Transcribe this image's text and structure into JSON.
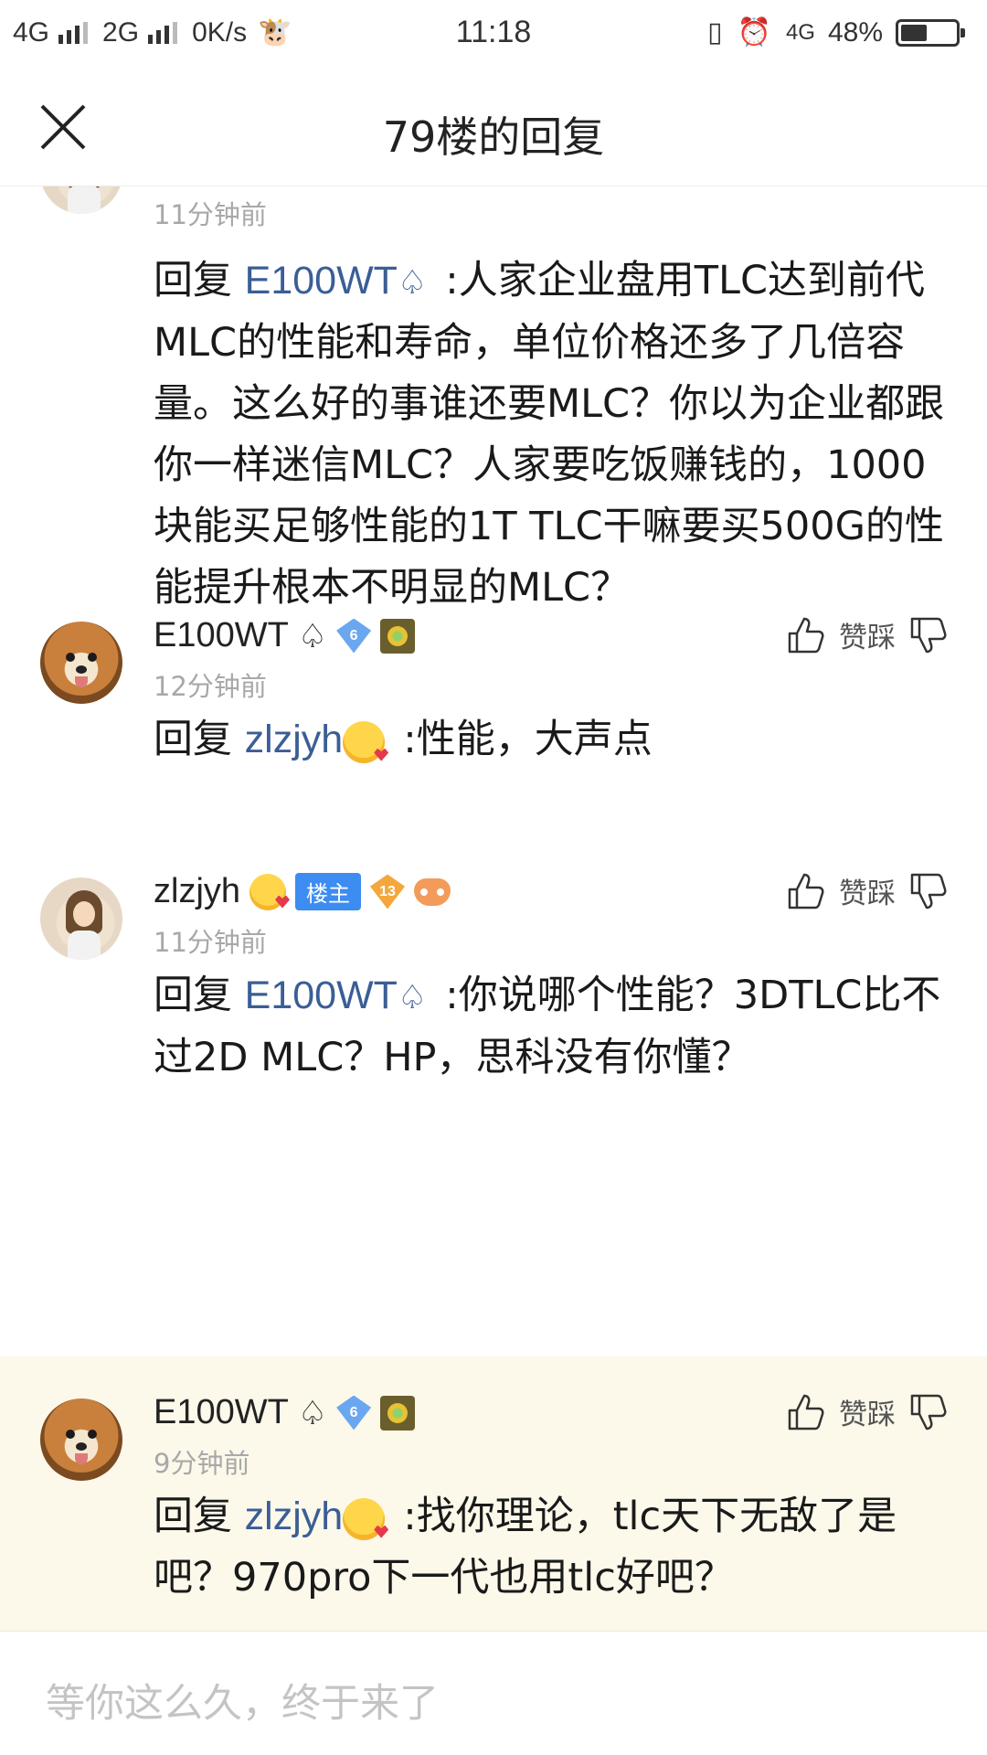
{
  "status_bar": {
    "network_1": "4G",
    "network_2": "2G",
    "speed": "0K/s",
    "time": "11:18",
    "network_3": "4G",
    "battery": "48%",
    "battery_level": 0.48
  },
  "header": {
    "title": "79楼的回复"
  },
  "replies": [
    {
      "time": "11分钟前",
      "reply_prefix": "回复",
      "mention": "E100WT",
      "body": ":人家企业盘用TLC达到前代MLC的性能和寿命，单位价格还多了几倍容量。这么好的事谁还要MLC？你以为企业都跟你一样迷信MLC？人家要吃饭赚钱的，1000块能买足够性能的1T TLC干嘛要买500G的性能提升根本不明显的MLC？"
    },
    {
      "username": "E100WT",
      "level": "6",
      "time": "12分钟前",
      "actions_label": "赞踩",
      "reply_prefix": "回复",
      "mention": "zlzjyh",
      "body": ":性能，大声点"
    },
    {
      "username": "zlzjyh",
      "owner_badge": "楼主",
      "level": "13",
      "time": "11分钟前",
      "actions_label": "赞踩",
      "reply_prefix": "回复",
      "mention": "E100WT",
      "body": ":你说哪个性能？3DTLC比不过2D MLC？HP，思科没有你懂？"
    },
    {
      "username": "E100WT",
      "level": "6",
      "time": "9分钟前",
      "actions_label": "赞踩",
      "reply_prefix": "回复",
      "mention": "zlzjyh",
      "body": ":找你理论，tlc天下无敌了是吧？970pro下一代也用tlc好吧？"
    }
  ],
  "input": {
    "placeholder": "等你这么久，终于来了"
  },
  "colors": {
    "mention": "#3a5e96",
    "highlight_bg": "#fcf8ea",
    "owner_badge": "#3c8cf2"
  }
}
